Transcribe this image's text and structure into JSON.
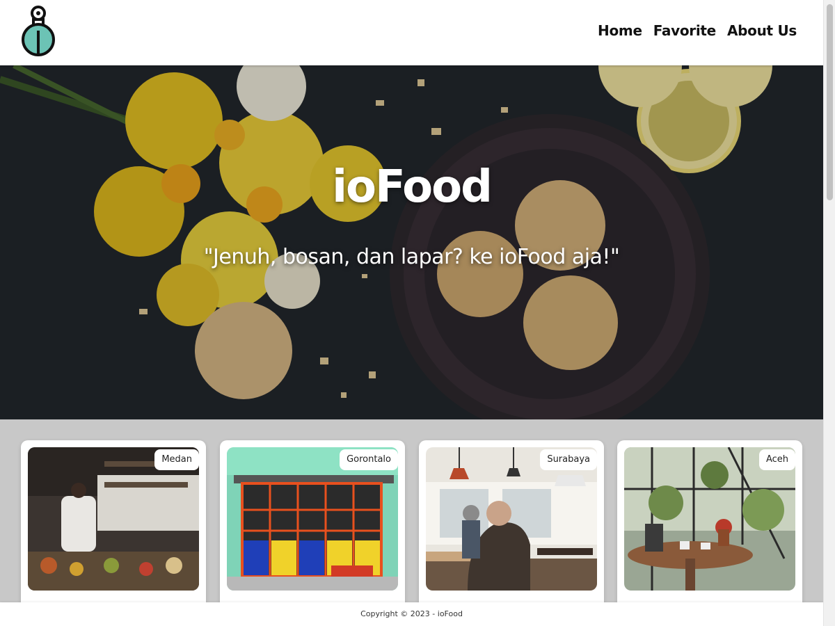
{
  "header": {
    "logo_icon": "flask-logo-icon",
    "nav": [
      {
        "label": "Home"
      },
      {
        "label": "Favorite"
      },
      {
        "label": "About Us"
      }
    ]
  },
  "hero": {
    "title": "ioFood",
    "tagline": "\"Jenuh, bosan, dan lapar? ke ioFood aja!\""
  },
  "restaurants": [
    {
      "city": "Medan"
    },
    {
      "city": "Gorontalo"
    },
    {
      "city": "Surabaya"
    },
    {
      "city": "Aceh"
    }
  ],
  "footer": {
    "copyright": "Copyright © 2023 - ioFood"
  },
  "colors": {
    "accent": "#6cc3b5",
    "page_bg": "#c8c8c8"
  }
}
